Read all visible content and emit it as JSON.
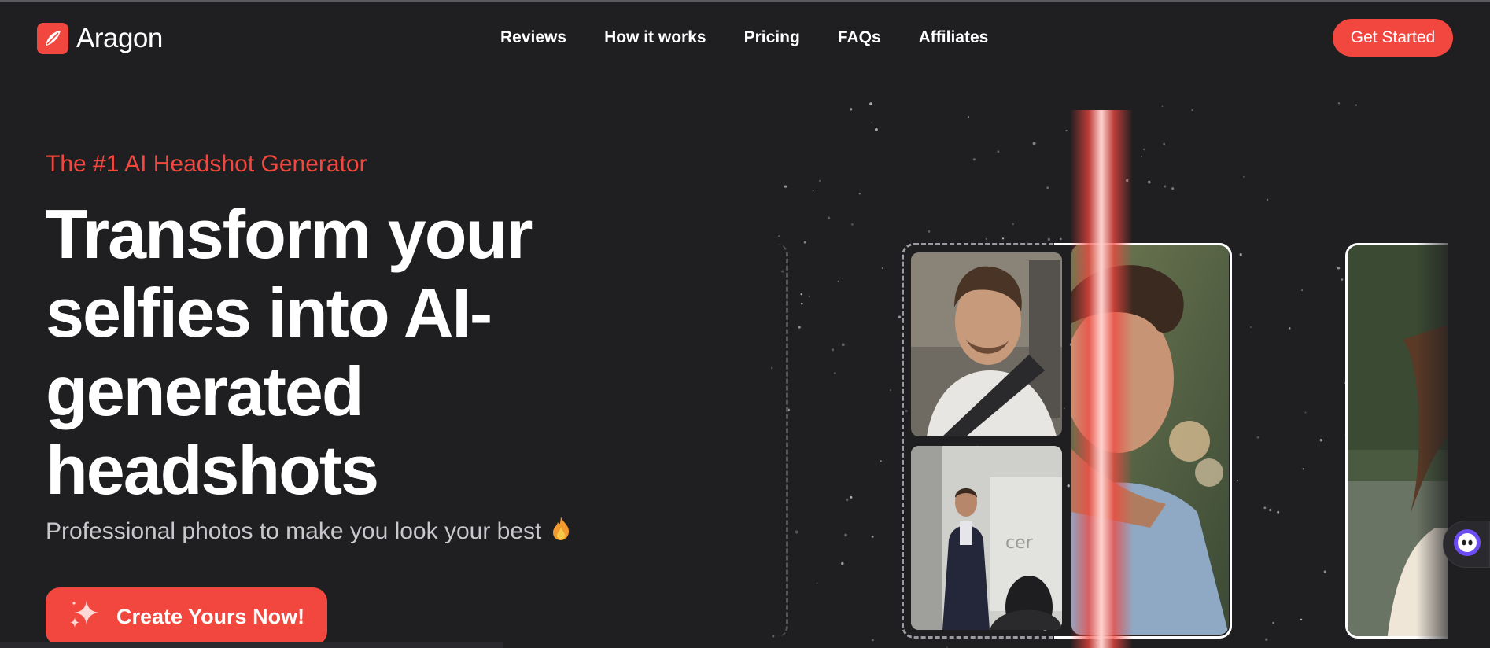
{
  "brand": {
    "name": "Aragon",
    "accent": "#f2473f",
    "background": "#1f1e21"
  },
  "nav": {
    "items": [
      "Reviews",
      "How it works",
      "Pricing",
      "FAQs",
      "Affiliates"
    ],
    "cta_label": "Get Started"
  },
  "hero": {
    "eyebrow": "The #1 AI Headshot Generator",
    "headline_lines": [
      "Transform your",
      "selfies into AI-",
      "generated",
      "headshots"
    ],
    "subline": "Professional photos to make you look your best",
    "subline_icon": "fire-icon",
    "cta_label": "Create Yours Now!",
    "cta_icon": "sparkle-icon"
  },
  "visual": {
    "photos": [
      {
        "name": "selfie-car-photo"
      },
      {
        "name": "selfie-presentation-photo"
      },
      {
        "name": "ai-headshot-photo"
      },
      {
        "name": "ai-headshot-preview-photo"
      }
    ]
  },
  "chat_widget": {
    "icon": "chat-bot-icon"
  }
}
